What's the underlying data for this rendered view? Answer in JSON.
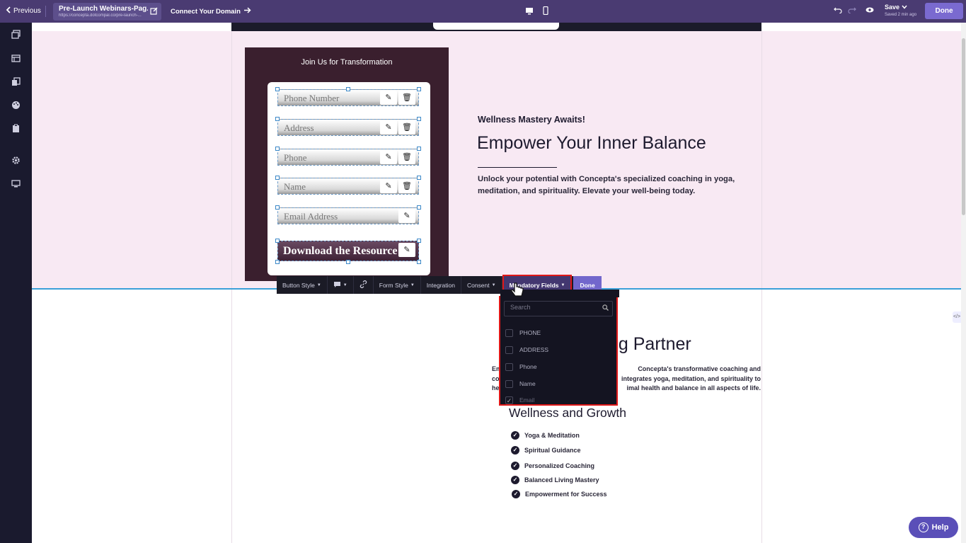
{
  "topbar": {
    "previous_label": "Previous",
    "page_title": "Pre-Launch Webinars-Pag...",
    "page_url": "https://concepta.dotcompal.co/pre-launch-...",
    "connect_domain_label": "Connect Your Domain",
    "save_label": "Save",
    "saved_status": "Saved 2 min ago",
    "done_label": "Done"
  },
  "sidebar": {
    "items": [
      "pages-icon",
      "layout-icon",
      "copy-icon",
      "palette-icon",
      "clipboard-icon",
      "settings-icon",
      "monitor-icon"
    ]
  },
  "form": {
    "heading": "Join Us for Transformation",
    "fields": [
      {
        "placeholder": "Phone Number",
        "deletable": true
      },
      {
        "placeholder": "Address",
        "deletable": true
      },
      {
        "placeholder": "Phone",
        "deletable": true
      },
      {
        "placeholder": "Name",
        "deletable": true
      },
      {
        "placeholder": "Email Address",
        "deletable": false
      }
    ],
    "button_label": "Download the Resource"
  },
  "hero": {
    "kicker": "Wellness Mastery Awaits!",
    "title": "Empower Your Inner Balance",
    "body": "Unlock your potential with Concepta's specialized coaching in yoga, meditation, and spirituality. Elevate your well-being today."
  },
  "toolbar": {
    "button_style": "Button Style",
    "form_style": "Form Style",
    "integration": "Integration",
    "consent": "Consent",
    "mandatory_fields": "Mandatory Fields",
    "done": "Done"
  },
  "dropdown": {
    "search_placeholder": "Search",
    "options": [
      {
        "label": "PHONE",
        "checked": false
      },
      {
        "label": "ADDRESS",
        "checked": false
      },
      {
        "label": "Phone",
        "checked": false
      },
      {
        "label": "Name",
        "checked": false
      },
      {
        "label": "Email",
        "checked": true
      }
    ]
  },
  "section2": {
    "title_visible": "ng Partner",
    "body_line1_left": "Em",
    "body_line1_right": "Concepta's transformative coaching and",
    "body_line2_left": "co",
    "body_line2_right": "integrates yoga, meditation, and spirituality to",
    "body_line3_left": "he",
    "body_line3_right": "imal health and balance in all aspects of life.",
    "subtitle": "Wellness and Growth",
    "bullets": [
      "Yoga & Meditation",
      "Spiritual Guidance",
      "Personalized Coaching",
      "Balanced Living Mastery",
      "Empowerment for Success"
    ]
  },
  "help_label": "Help",
  "colors": {
    "topbar": "#4a3b72",
    "sidebar": "#1a1a2e",
    "hero_band": "#f8e9f3",
    "form_box": "#3a1f2e",
    "accent": "#7a6ad0",
    "highlight": "#e01818"
  }
}
